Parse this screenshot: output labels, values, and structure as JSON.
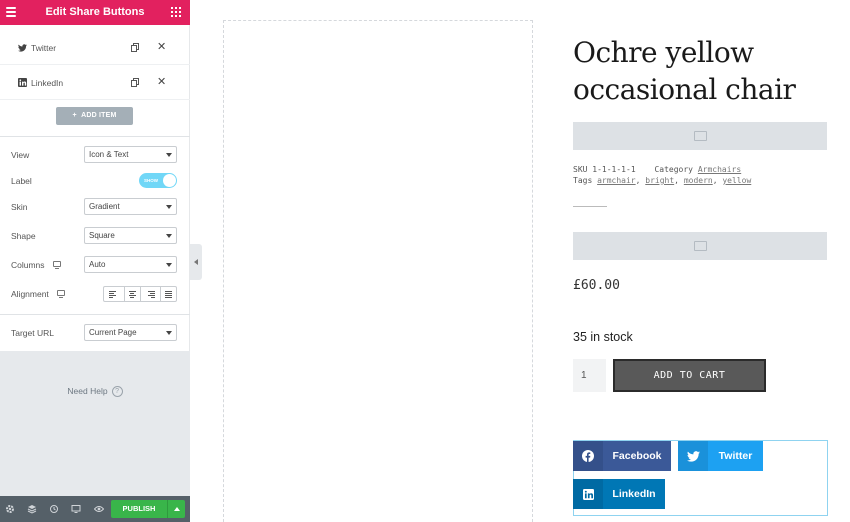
{
  "editor": {
    "title": "Edit Share Buttons",
    "items": [
      {
        "label": "Twitter",
        "icon": "twitter-icon"
      },
      {
        "label": "LinkedIn",
        "icon": "linkedin-icon"
      }
    ],
    "add_item_label": "ADD ITEM",
    "controls": {
      "view": {
        "label": "View",
        "value": "Icon & Text"
      },
      "label": {
        "label": "Label",
        "toggle_text": "SHOW",
        "on": true
      },
      "skin": {
        "label": "Skin",
        "value": "Gradient"
      },
      "shape": {
        "label": "Shape",
        "value": "Square"
      },
      "columns": {
        "label": "Columns",
        "value": "Auto"
      },
      "alignment": {
        "label": "Alignment",
        "options": [
          "left",
          "center",
          "right",
          "justify"
        ]
      },
      "target_url": {
        "label": "Target URL",
        "value": "Current Page"
      }
    },
    "need_help": "Need Help",
    "footer": {
      "publish_label": "PUBLISH"
    },
    "colors": {
      "header": "#e2215f",
      "toggle": "#71d7f7",
      "publish": "#39b54a",
      "footer": "#556068"
    }
  },
  "product": {
    "title_line1": "Ochre yellow",
    "title_line2": "occasional chair",
    "sku_label": "SKU",
    "sku": "1-1-1-1-1",
    "category_label": "Category",
    "category": "Armchairs",
    "tags_label": "Tags",
    "tags": [
      "armchair",
      "bright",
      "modern",
      "yellow"
    ],
    "price": "£60.00",
    "stock": "35 in stock",
    "quantity": "1",
    "add_to_cart": "ADD TO CART"
  },
  "share": [
    {
      "label": "Facebook",
      "icon": "facebook-icon",
      "color": "#3b5998"
    },
    {
      "label": "Twitter",
      "icon": "twitter-icon",
      "color": "#1da1f2"
    },
    {
      "label": "LinkedIn",
      "icon": "linkedin-icon",
      "color": "#0077b5"
    }
  ]
}
